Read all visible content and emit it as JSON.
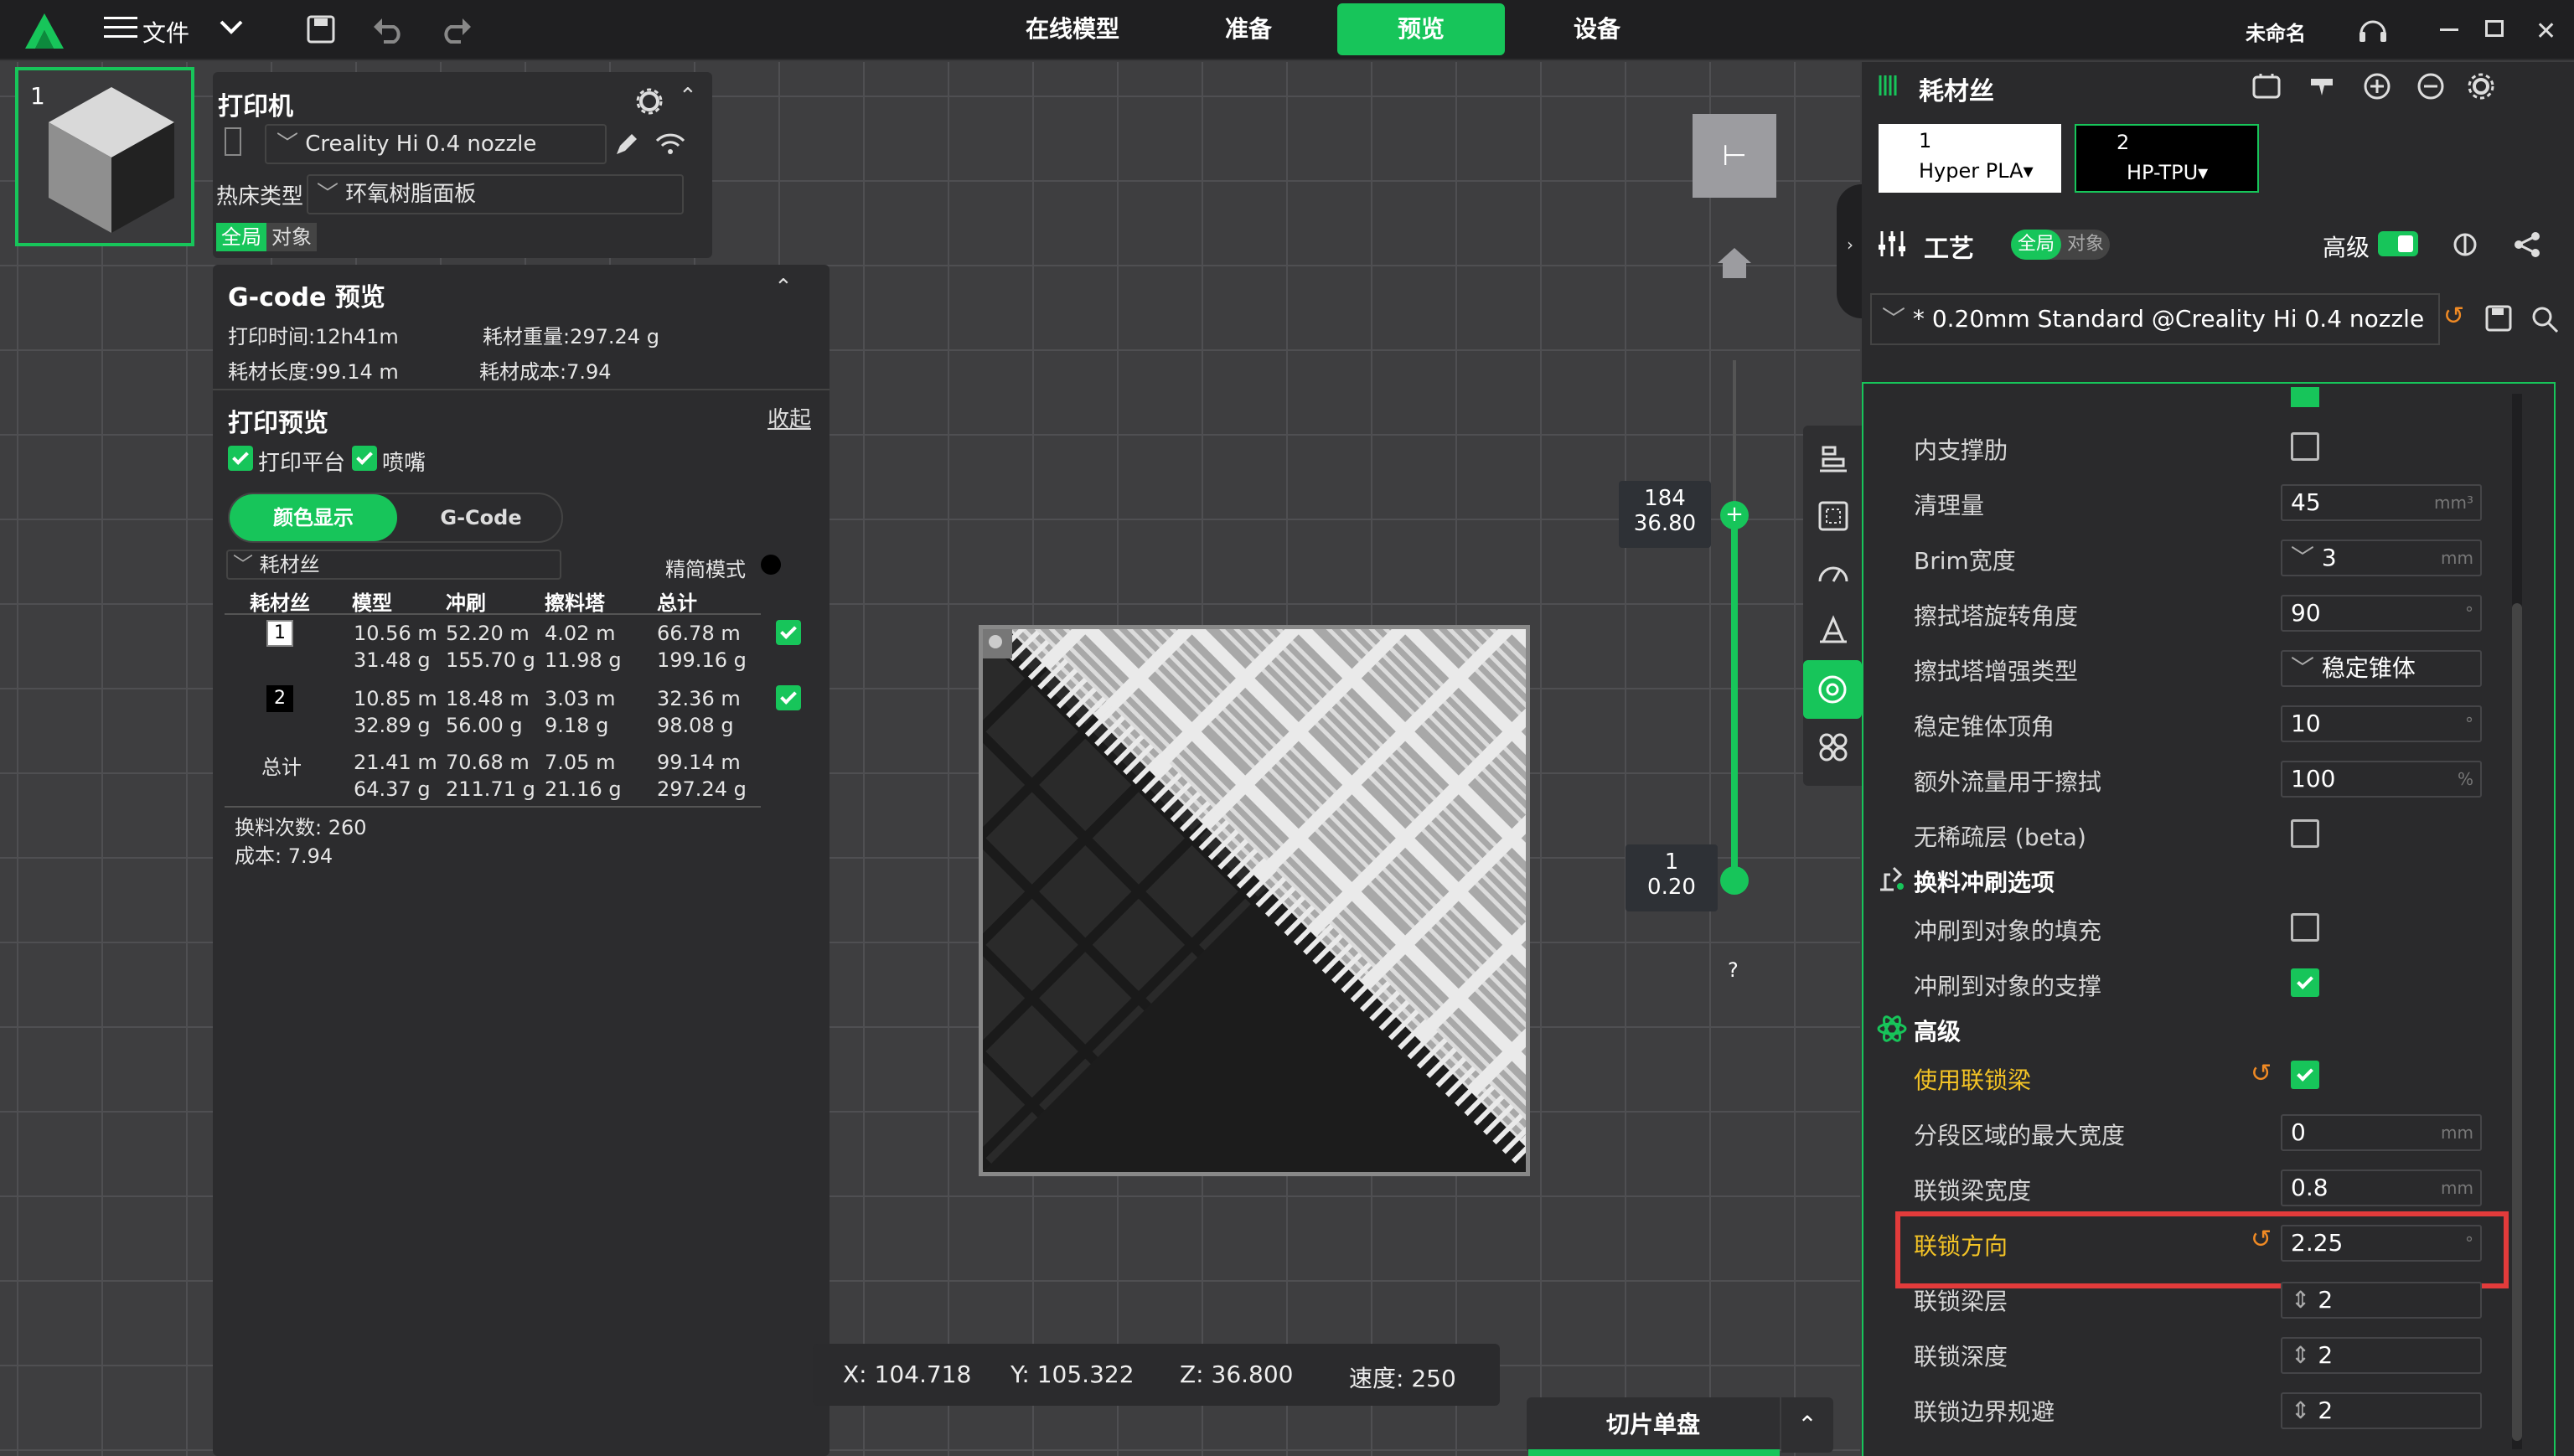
{
  "app": {
    "logo": "creality-logo",
    "file_menu": "文件",
    "unnamed": "未命名"
  },
  "tabs": [
    {
      "label": "在线模型"
    },
    {
      "label": "准备"
    },
    {
      "label": "预览"
    },
    {
      "label": "设备"
    }
  ],
  "printer": {
    "title": "打印机",
    "name": "Creality Hi 0.4 nozzle",
    "bed_label": "热床类型",
    "bed_value": "环氧树脂面板",
    "scope_all": "全局",
    "scope_obj": "对象"
  },
  "plate": {
    "number": "1"
  },
  "gcode": {
    "title": "G-code 预览",
    "print_time": "打印时间:12h41m",
    "weight": "耗材重量:297.24 g",
    "length": "耗材长度:99.14 m",
    "cost": "耗材成本:7.94",
    "preview_title": "打印预览",
    "collapse": "收起",
    "show_platform": "打印平台",
    "show_nozzle": "喷嘴",
    "mode_color": "颜色显示",
    "mode_gcode": "G-Code",
    "filament_dropdown": "耗材丝",
    "simple_mode": "精简模式",
    "headers": [
      "耗材丝",
      "模型",
      "冲刷",
      "擦料塔",
      "总计"
    ],
    "rows": [
      {
        "id": "1",
        "model": "10.56 m",
        "model_g": "31.48 g",
        "flush": "52.20 m",
        "flush_g": "155.70 g",
        "tower": "4.02 m",
        "tower_g": "11.98 g",
        "total": "66.78 m",
        "total_g": "199.16 g"
      },
      {
        "id": "2",
        "model": "10.85 m",
        "model_g": "32.89 g",
        "flush": "18.48 m",
        "flush_g": "56.00 g",
        "tower": "3.03 m",
        "tower_g": "9.18 g",
        "total": "32.36 m",
        "total_g": "98.08 g"
      }
    ],
    "total_row": {
      "label": "总计",
      "model": "21.41 m",
      "model_g": "64.37 g",
      "flush": "70.68 m",
      "flush_g": "211.71 g",
      "tower": "7.05 m",
      "tower_g": "21.16 g",
      "total": "99.14 m",
      "total_g": "297.24 g"
    },
    "changes": "换料次数: 260",
    "cost2": "成本: 7.94"
  },
  "slider": {
    "top_layer": "184",
    "top_height": "36.80",
    "bottom_layer": "1",
    "bottom_height": "0.20",
    "help": "?"
  },
  "status": {
    "x": "X: 104.718",
    "y": "Y: 105.322",
    "z": "Z: 36.800",
    "speed": "速度: 250"
  },
  "slice_button": "切片单盘",
  "filament": {
    "title": "耗材丝",
    "slots": [
      {
        "num": "1",
        "name": "Hyper PLA",
        "color": "#ffffff"
      },
      {
        "num": "2",
        "name": "HP-TPU",
        "color": "#000000"
      }
    ]
  },
  "process": {
    "title": "工艺",
    "scope_all": "全局",
    "scope_obj": "对象",
    "advanced": "高级",
    "preset": "* 0.20mm Standard @Creality Hi 0.4 nozzle"
  },
  "settings": [
    {
      "label": "内支撑肋",
      "type": "check",
      "checked": false
    },
    {
      "label": "清理量",
      "value": "45",
      "unit": "mm³"
    },
    {
      "label": "Brim宽度",
      "value": "3",
      "unit": "mm",
      "spin": true
    },
    {
      "label": "擦拭塔旋转角度",
      "value": "90",
      "unit": "°"
    },
    {
      "label": "擦拭塔增强类型",
      "value": "稳定锥体",
      "dropdown": true
    },
    {
      "label": "稳定锥体顶角",
      "value": "10",
      "unit": "°"
    },
    {
      "label": "额外流量用于擦拭",
      "value": "100",
      "unit": "%"
    },
    {
      "label": "无稀疏层 (beta)",
      "type": "check",
      "checked": false
    }
  ],
  "section_flush": "换料冲刷选项",
  "flush_settings": [
    {
      "label": "冲刷到对象的填充",
      "checked": false
    },
    {
      "label": "冲刷到对象的支撑",
      "checked": true
    }
  ],
  "section_adv": "高级",
  "adv_settings": [
    {
      "label": "使用联锁梁"
    },
    {
      "label": "分段区域的最大宽度",
      "value": "0",
      "unit": "mm"
    },
    {
      "label": "联锁梁宽度",
      "value": "0.8",
      "unit": "mm"
    },
    {
      "label": "联锁方向",
      "value": "2.25",
      "unit": "°"
    },
    {
      "label": "联锁梁层",
      "value": "2"
    },
    {
      "label": "联锁深度",
      "value": "2"
    },
    {
      "label": "联锁边界规避",
      "value": "2"
    }
  ],
  "colors": {
    "accent": "#17c55a",
    "highlight": "#e23b3b",
    "modified": "#f3c326"
  }
}
